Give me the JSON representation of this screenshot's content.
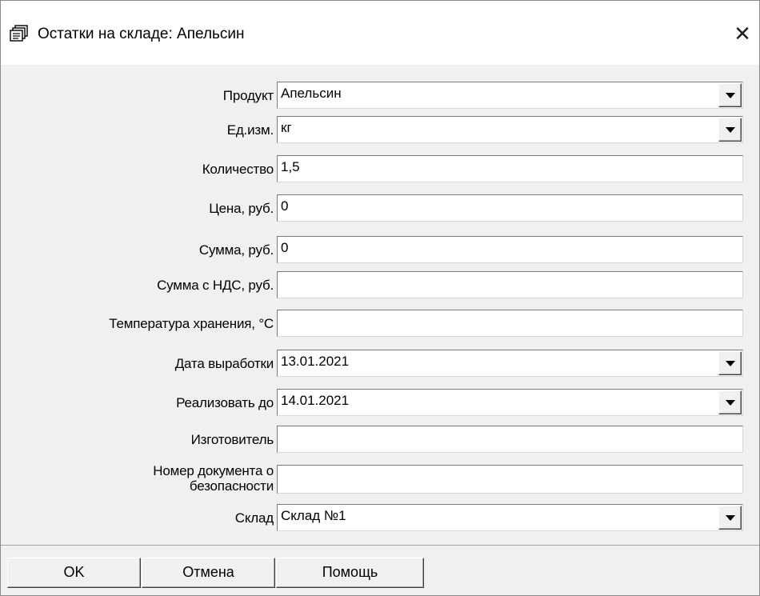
{
  "window": {
    "title": "Остатки на складе: Апельсин",
    "close_glyph": "✕"
  },
  "form": {
    "product": {
      "label": "Продукт",
      "value": "Апельсин"
    },
    "unit": {
      "label": "Ед.изм.",
      "value": "кг"
    },
    "quantity": {
      "label": "Количество",
      "value": "1,5"
    },
    "price": {
      "label": "Цена, руб.",
      "value": "0"
    },
    "sum": {
      "label": "Сумма, руб.",
      "value": "0"
    },
    "sum_vat": {
      "label": "Сумма с НДС, руб.",
      "value": ""
    },
    "storage_temp": {
      "label": "Температура хранения, °С",
      "value": ""
    },
    "production_date": {
      "label": "Дата выработки",
      "value": "13.01.2021"
    },
    "sell_by": {
      "label": "Реализовать до",
      "value": "14.01.2021"
    },
    "manufacturer": {
      "label": "Изготовитель",
      "value": ""
    },
    "safety_doc": {
      "label_line1": "Номер документа о",
      "label_line2": "безопасности",
      "value": ""
    },
    "warehouse": {
      "label": "Склад",
      "value": "Склад №1"
    }
  },
  "buttons": {
    "ok": "OK",
    "cancel": "Отмена",
    "help": "Помощь"
  }
}
